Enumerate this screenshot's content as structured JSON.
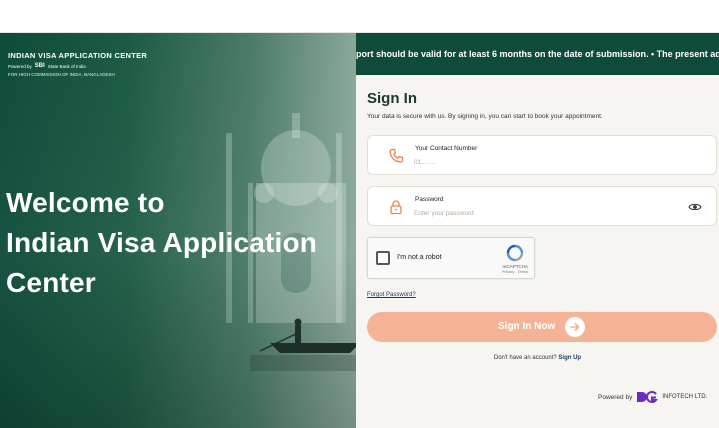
{
  "brand": {
    "title": "INDIAN VISA APPLICATION CENTER",
    "powered": "Powered by",
    "sbi": "SBI",
    "sbi_full": "State Bank of India",
    "footer": "FOR HIGH COMMISSION OF INDIA, BANGLADESH"
  },
  "hero": {
    "line1": "Welcome to",
    "line2": "Indian Visa Application",
    "line3": "Center"
  },
  "ticker": "port should be valid for at least 6 months on the date of submission. • The present address me",
  "signin": {
    "title": "Sign In",
    "subtitle": "Your data is secure with us. By signing in, you can start to book your appointment."
  },
  "contact": {
    "label": "Your Contact Number",
    "placeholder": "01........"
  },
  "password": {
    "label": "Password",
    "placeholder": "Enter your password"
  },
  "captcha": {
    "label": "I'm not a robot",
    "brand": "reCAPTCHA",
    "links": "Privacy - Terms"
  },
  "forgot": "Forgot Password?",
  "button": {
    "label": "Sign In Now"
  },
  "account": {
    "question": "Don't have an account?",
    "link": "Sign Up"
  },
  "footer": {
    "powered": "Powered by",
    "company": "INFOTECH LTD."
  },
  "colors": {
    "primary_green": "#0e4b3a",
    "button_peach": "#f4b394",
    "accent_orange": "#e8834a"
  },
  "icons": [
    "phone-icon",
    "lock-icon",
    "eye-icon",
    "arrow-right-icon",
    "recaptcha-icon",
    "dg-logo-icon"
  ]
}
